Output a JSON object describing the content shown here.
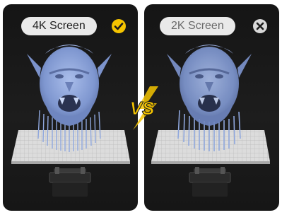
{
  "panels": [
    {
      "label": "4K Screen",
      "status_icon": "checkmark-icon",
      "status_color": "#f5c400"
    },
    {
      "label": "2K Screen",
      "status_icon": "close-icon",
      "status_color": "#d9d9d9"
    }
  ],
  "versus": "VS",
  "colors": {
    "model_blue": "#8fa7dd",
    "accent_yellow": "#f5c400",
    "panel_bg": "#1b1b1b"
  }
}
